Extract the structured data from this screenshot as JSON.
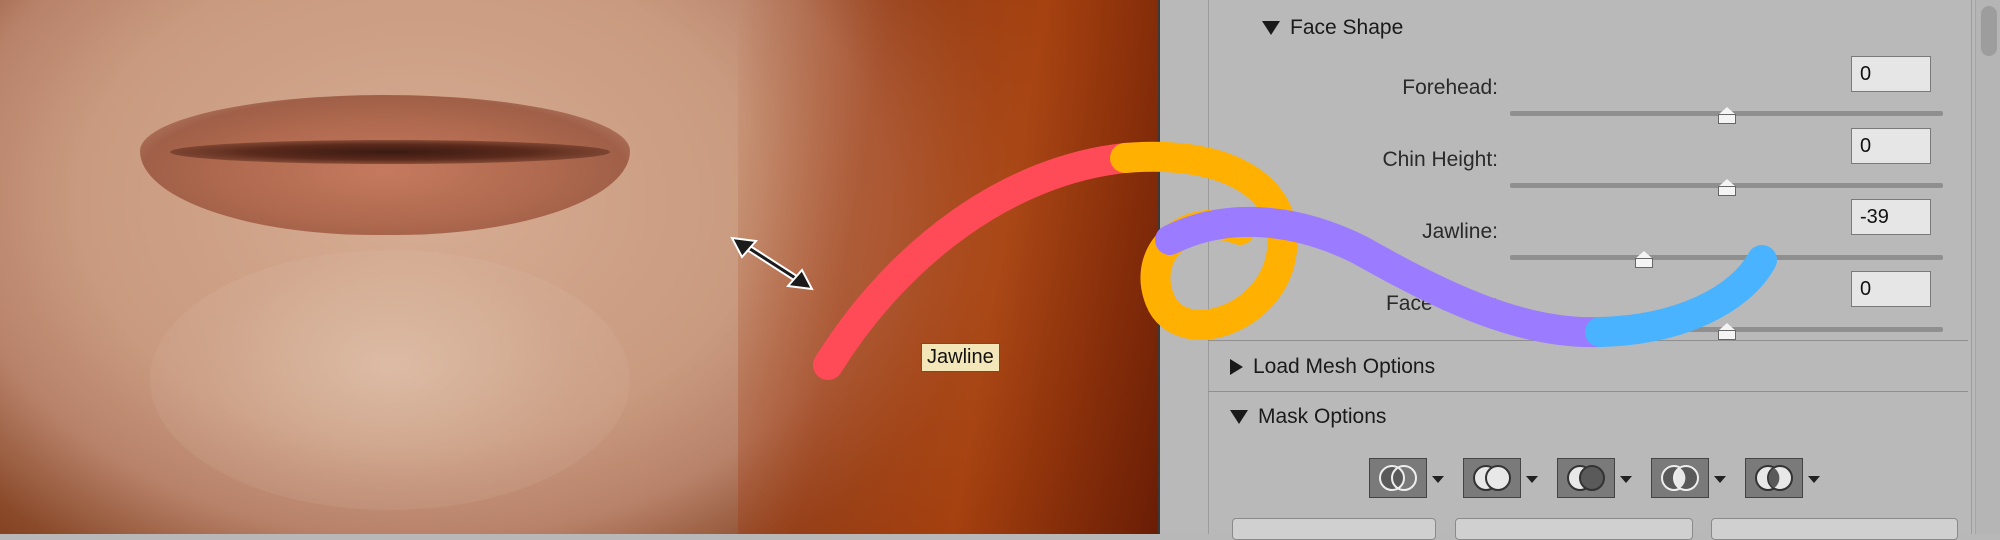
{
  "tooltip": {
    "text": "Jawline"
  },
  "panel": {
    "face_shape": {
      "title": "Face Shape",
      "rows": [
        {
          "label": "Forehead:",
          "value": "0",
          "slider_percent": 50
        },
        {
          "label": "Chin Height:",
          "value": "0",
          "slider_percent": 50
        },
        {
          "label": "Jawline:",
          "value": "-39",
          "slider_percent": 31
        },
        {
          "label": "Face Width:",
          "value": "0",
          "slider_percent": 50
        }
      ]
    },
    "load_mesh": {
      "title": "Load Mesh Options"
    },
    "mask_options": {
      "title": "Mask Options",
      "buttons": [
        "mask-icon",
        "mask-icon",
        "mask-icon",
        "mask-icon",
        "mask-icon"
      ]
    }
  },
  "annotation_colors": [
    "#ff4a58",
    "#ffb000",
    "#9b7bff",
    "#4ab3ff"
  ]
}
